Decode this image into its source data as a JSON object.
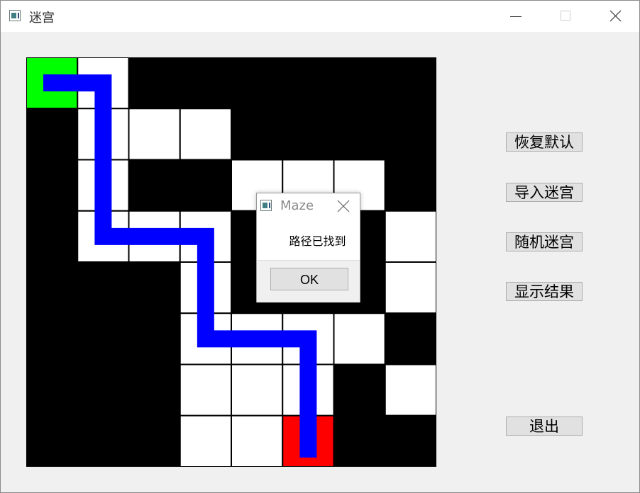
{
  "window": {
    "title": "迷宫",
    "icon": "app-icon"
  },
  "maze": {
    "rows": 8,
    "cols": 8,
    "cells": [
      "SP000000",
      "0PPP0000",
      "0P00PPP0",
      "0PPP0P0P",
      "000P000P",
      "000PPPP0",
      "000PPP0P",
      "000PPE00"
    ],
    "path": [
      [
        0,
        0
      ],
      [
        0,
        1
      ],
      [
        1,
        1
      ],
      [
        2,
        1
      ],
      [
        3,
        1
      ],
      [
        3,
        2
      ],
      [
        3,
        3
      ],
      [
        4,
        3
      ],
      [
        5,
        3
      ],
      [
        5,
        4
      ],
      [
        5,
        5
      ],
      [
        6,
        5
      ],
      [
        7,
        5
      ]
    ],
    "colors": {
      "wall": "#000000",
      "open": "#ffffff",
      "start": "#00ff00",
      "end": "#ff0000",
      "path": "#0000ff",
      "grid": "#000000"
    }
  },
  "buttons": {
    "restore_default": "恢复默认",
    "import_maze": "导入迷宫",
    "random_maze": "随机迷宫",
    "show_result": "显示结果",
    "exit": "退出"
  },
  "dialog": {
    "title": "Maze",
    "message": "路径已找到",
    "ok_label": "OK"
  }
}
